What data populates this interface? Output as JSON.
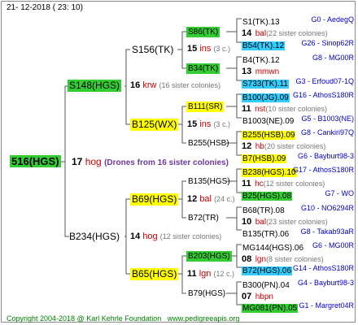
{
  "header": {
    "date": "21- 12-2018 ( 23: 10)"
  },
  "footer": {
    "copyright": "Copyright 2004-2018 @ Karl Kehrle Foundation",
    "site": "www.pedigreeapis.org"
  },
  "colors": {
    "green": "#33cc33",
    "yellow": "#ffff00",
    "cyan": "#33ccff",
    "line": "#555555"
  },
  "root": {
    "label": "516(HGS)",
    "num": "17",
    "word": "hog",
    "note": "(Drones from 16 sister colonies)"
  },
  "gen1": [
    {
      "label": "S148(HGS)",
      "num": "16",
      "word": "krw",
      "note": "(16 sister colonies)"
    },
    {
      "label": "B234(HGS)",
      "num": "14",
      "word": "hog",
      "note": "(12 sister colonies)"
    }
  ],
  "gen2": [
    {
      "label": "S156(TK)",
      "num": "15",
      "word": "ins",
      "note": "(3 c.)"
    },
    {
      "label": "B125(WX)",
      "num": "15",
      "word": "ins",
      "note": "(3 c.)"
    },
    {
      "label": "B69(HGS)",
      "num": "12",
      "word": "bal",
      "note": "(24 c.)"
    },
    {
      "label": "B65(HGS)",
      "num": "11",
      "word": "lgn",
      "note": "(12 c.)"
    }
  ],
  "gen3": [
    {
      "label": "S86(TK)"
    },
    {
      "label": "B34(TK)"
    },
    {
      "label": "B111(SR)"
    },
    {
      "label": "B255(HSB)"
    },
    {
      "label": "B135(HGS)"
    },
    {
      "label": "B72(TR)"
    },
    {
      "label": "B203(HGS)"
    },
    {
      "label": "B79(HGS)"
    }
  ],
  "gen4": [
    {
      "name": "S1(TK).13",
      "code": "G0 - AedegQ"
    },
    {
      "num": "14",
      "word": "bal",
      "note": "(22 sister colonies)"
    },
    {
      "name": "B54(TK).12",
      "code": "G26 - Sinop62R"
    },
    {
      "name": "B4(TK).12",
      "code": "G8 - MG00R"
    },
    {
      "num": "13",
      "word": "mmwn",
      "note": ""
    },
    {
      "name": "S733(TK).11",
      "code": "G3 - Erfoud07-1Q"
    },
    {
      "name": "B100(JG).09",
      "code": "G16 - AthosS180R"
    },
    {
      "num": "11",
      "word": "nst",
      "note": "(10 sister colonies)"
    },
    {
      "name": "B1003(NE).09",
      "code": "G5 - B1003(NE)"
    },
    {
      "name": "B255(HSB).09",
      "code": "G8 - Cankiri97Q"
    },
    {
      "num": "12",
      "word": "hb",
      "note": "(20 sister colonies)"
    },
    {
      "name": "B7(HSB).09",
      "code": "G6 - Bayburt98-3"
    },
    {
      "name": "B238(HGS).10",
      "code": "G17 - AthosS180R"
    },
    {
      "num": "11",
      "word": "hc",
      "note": "(12 sister colonies)"
    },
    {
      "name": "B25(HGS).08",
      "code": "G7 - WO"
    },
    {
      "name": "B68(TR).08",
      "code": "G10 - NO6294R"
    },
    {
      "num": "10",
      "word": "bal",
      "note": "(23 sister colonies)"
    },
    {
      "name": "B135(TR).06",
      "code": "G8 - Takab93aR"
    },
    {
      "name": "MG144(HGS).06",
      "code": "G6 - MG00R"
    },
    {
      "num": "08",
      "word": "lgn",
      "note": "(8 sister colonies)"
    },
    {
      "name": "B72(HGS).06",
      "code": "G14 - AthosS180R"
    },
    {
      "name": "B300(PN).04",
      "code": "G4 - Bayburt98-3"
    },
    {
      "num": "07",
      "word": "hbpn",
      "note": ""
    },
    {
      "name": "MG081(PN).05",
      "code": "G1 - Margret04R"
    }
  ]
}
